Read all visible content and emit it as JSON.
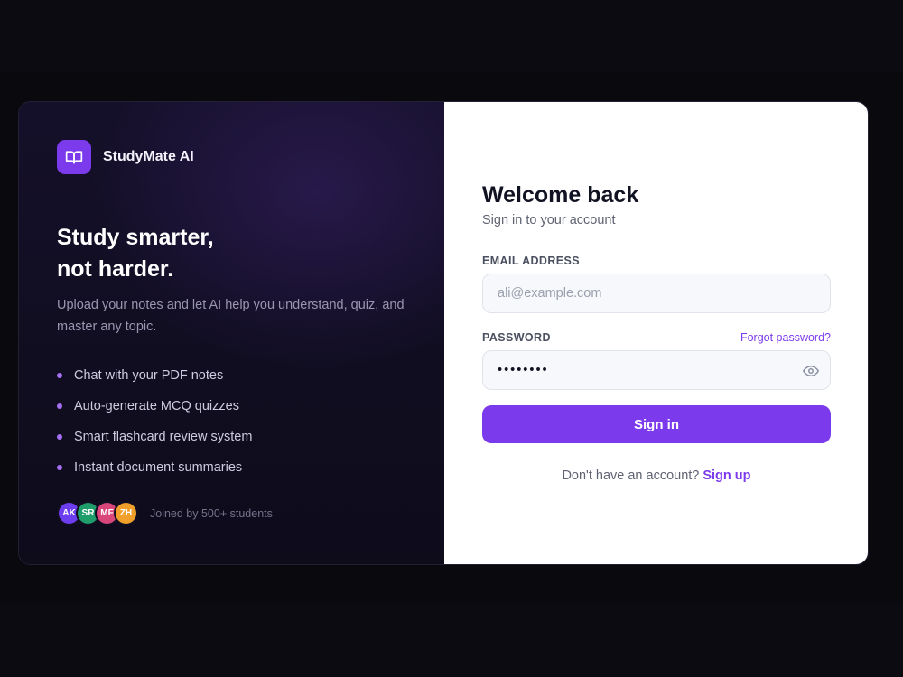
{
  "brand": {
    "name": "StudyMate AI",
    "icon": "open-book-icon",
    "accent": "#7c3aed"
  },
  "hero": {
    "headline_line1": "Study smarter,",
    "headline_line2": "not harder.",
    "subtext": "Upload your notes and let AI help you understand, quiz, and master any topic."
  },
  "features": [
    "Chat with your PDF notes",
    "Auto-generate MCQ quizzes",
    "Smart flashcard review system",
    "Instant document summaries"
  ],
  "social_proof": {
    "avatars": [
      {
        "initials": "AK",
        "color": "#6d3df0"
      },
      {
        "initials": "SR",
        "color": "#1f9d6b"
      },
      {
        "initials": "MF",
        "color": "#d9467a"
      },
      {
        "initials": "ZH",
        "color": "#f0a02a"
      }
    ],
    "text": "Joined by 500+ students"
  },
  "form": {
    "title": "Welcome back",
    "subtitle": "Sign in to your account",
    "email_label": "EMAIL ADDRESS",
    "email_placeholder": "ali@example.com",
    "password_label": "PASSWORD",
    "forgot_label": "Forgot password?",
    "password_value": "••••••••",
    "toggle_icon": "eye-icon",
    "submit_label": "Sign in",
    "signup_prompt": "Don't have an account?",
    "signup_link": "Sign up"
  }
}
